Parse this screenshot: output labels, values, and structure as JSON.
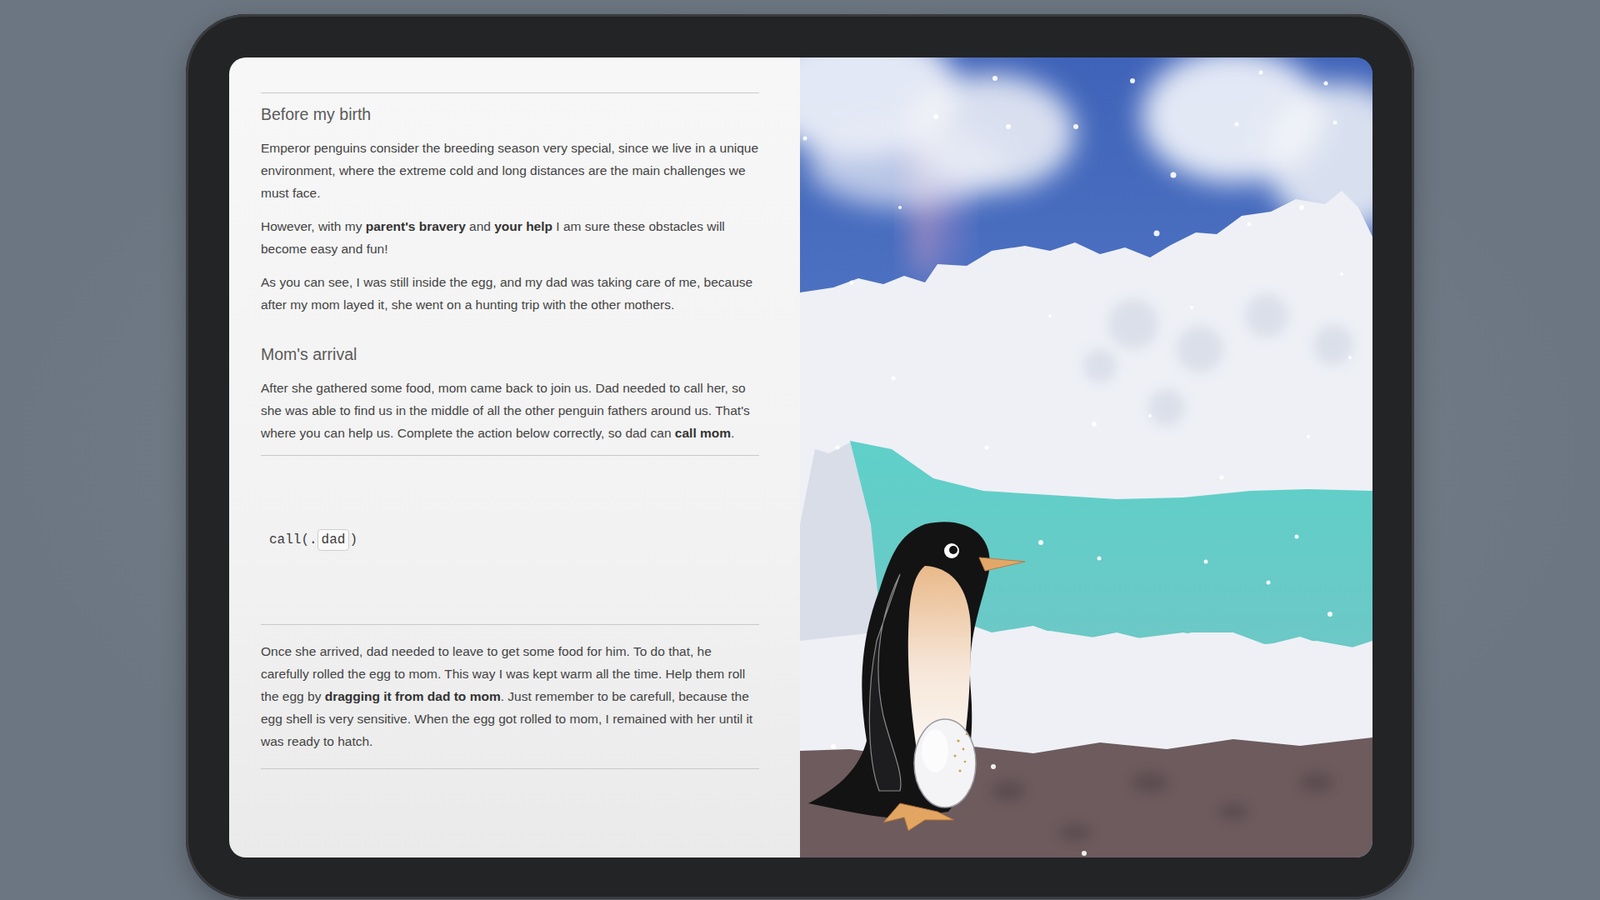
{
  "story": {
    "intro_sections": [
      {
        "heading": "Before my birth",
        "paragraphs": [
          [
            {
              "text": "Emperor penguins consider the breeding season very special, since we live in a unique environment, where the extreme cold and long distances are the main challenges we must face.",
              "bold": false
            }
          ],
          [
            {
              "text": "However, with my ",
              "bold": false
            },
            {
              "text": "parent's bravery",
              "bold": true
            },
            {
              "text": " and ",
              "bold": false
            },
            {
              "text": "your help",
              "bold": true
            },
            {
              "text": " I am sure these obstacles will become easy and fun!",
              "bold": false
            }
          ],
          [
            {
              "text": "As you can see, I was still inside the egg, and my dad was taking care of me, because after my mom layed it, she went on a hunting trip with the other mothers.",
              "bold": false
            }
          ]
        ]
      },
      {
        "heading": "Mom's arrival",
        "paragraphs": [
          [
            {
              "text": "After she gathered some food, mom came back to join us. Dad needed to call her, so she was able to find us in the middle of all the other penguin fathers around us. That's where you can help us. Complete the action below correctly, so dad can ",
              "bold": false
            },
            {
              "text": "call mom",
              "bold": true
            },
            {
              "text": ".",
              "bold": false
            }
          ]
        ]
      }
    ],
    "action": {
      "code_prefix": "call(.",
      "token": "dad",
      "code_suffix": ")"
    },
    "outro": {
      "paragraphs": [
        [
          {
            "text": "Once she arrived, dad needed to leave to get some food for him. To do that, he carefully rolled the egg to mom. This way I was kept warm all the time. Help them roll the egg by ",
            "bold": false
          },
          {
            "text": "dragging it from dad to mom",
            "bold": true
          },
          {
            "text": ". Just remember to be carefull, because the egg shell is very sensitive. When the egg got rolled to mom, I remained with her until it was ready to hatch.",
            "bold": false
          }
        ]
      ]
    }
  }
}
